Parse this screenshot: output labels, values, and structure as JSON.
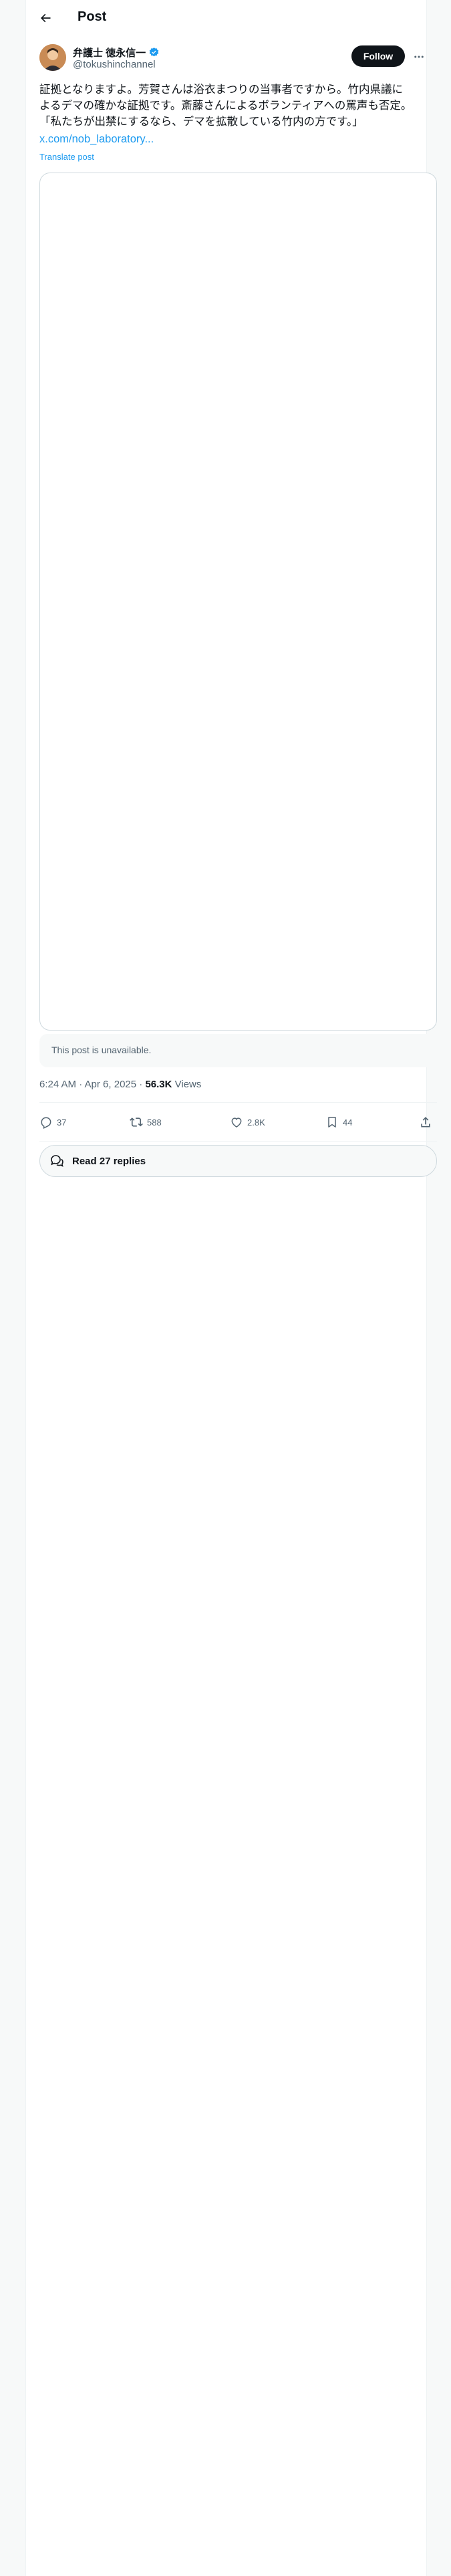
{
  "header": {
    "title": "Post"
  },
  "author": {
    "name": "弁護士 徳永信一",
    "handle": "@tokushinchannel",
    "follow_label": "Follow"
  },
  "post": {
    "text": "証拠となりますよ。芳賀さんは浴衣まつりの当事者ですから。竹内県議によるデマの確かな証拠です。斎藤さんによるボランティアへの罵声も否定。「私たちが出禁にするなら、デマを拡散している竹内の方です。」",
    "link": "x.com/nob_laboratory...",
    "translate_label": "Translate post",
    "unavailable_text": "This post is unavailable.",
    "time": "6:24 AM · Apr 6, 2025 · ",
    "views_count": "56.3K",
    "views_label": " Views"
  },
  "actions": {
    "replies": "37",
    "reposts": "588",
    "likes": "2.8K",
    "bookmarks": "44"
  },
  "replies_button": {
    "label": "Read 27 replies"
  },
  "icons": {
    "back": "arrow-left-icon",
    "verified": "verified-badge-icon",
    "more": "more-icon",
    "reply": "reply-icon",
    "repost": "repost-icon",
    "like": "heart-icon",
    "bookmark": "bookmark-icon",
    "share": "share-icon",
    "replies": "chat-bubbles-icon"
  },
  "colors": {
    "accent": "#1d9bf0",
    "text": "#0f1419",
    "muted": "#536471"
  }
}
